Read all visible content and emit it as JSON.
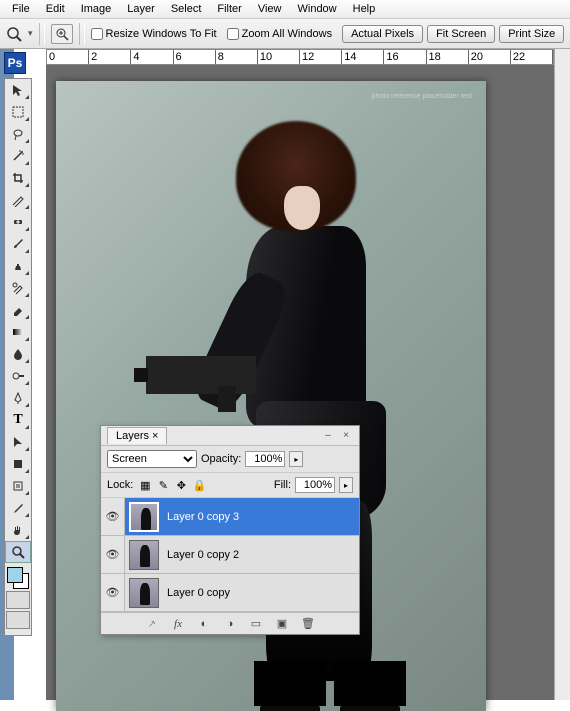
{
  "menu": {
    "items": [
      "File",
      "Edit",
      "Image",
      "Layer",
      "Select",
      "Filter",
      "View",
      "Window",
      "Help"
    ]
  },
  "optbar": {
    "resize_label": "Resize Windows To Fit",
    "zoom_all_label": "Zoom All Windows",
    "btn_actual": "Actual Pixels",
    "btn_fit": "Fit Screen",
    "btn_print": "Print Size"
  },
  "ruler": [
    "0",
    "2",
    "4",
    "6",
    "8",
    "10",
    "12",
    "14",
    "16",
    "18",
    "20",
    "22"
  ],
  "ps_logo": "Ps",
  "layers_panel": {
    "title": "Layers",
    "close_x": "×",
    "blend_mode": "Screen",
    "opacity_label": "Opacity:",
    "opacity_value": "100%",
    "lock_label": "Lock:",
    "fill_label": "Fill:",
    "fill_value": "100%",
    "layers": [
      {
        "name": "Layer 0 copy 3",
        "selected": true
      },
      {
        "name": "Layer 0 copy 2",
        "selected": false
      },
      {
        "name": "Layer 0 copy",
        "selected": false
      }
    ],
    "footer_icons": [
      "link",
      "fx",
      "mask",
      "adjust",
      "group",
      "new",
      "trash"
    ]
  },
  "canvas_credit": "photo reference\nplaceholder text"
}
